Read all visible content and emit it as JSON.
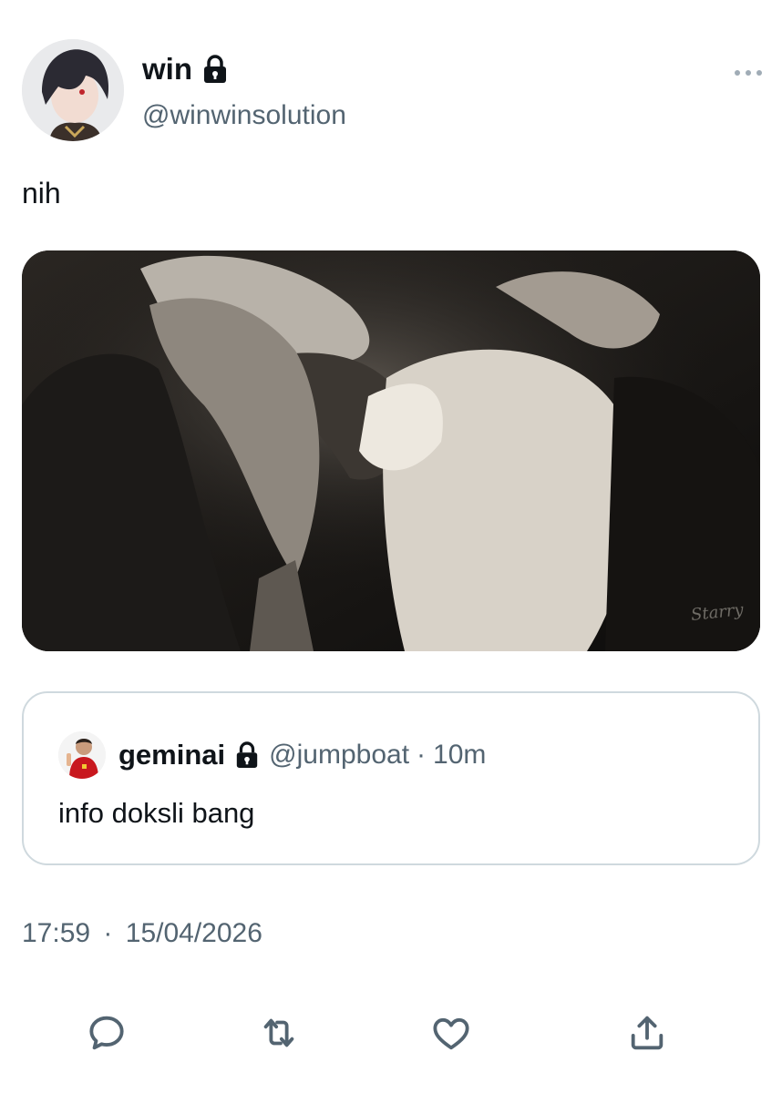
{
  "author": {
    "display_name": "win",
    "handle": "@winwinsolution",
    "verified_lock": true
  },
  "tweet": {
    "text": "nih",
    "media_watermark": "Starry"
  },
  "quoted": {
    "display_name": "geminai",
    "handle": "@jumpboat",
    "separator": "·",
    "age": "10m",
    "text": "info doksli bang"
  },
  "timestamp": {
    "time": "17:59",
    "separator": "·",
    "date": "15/04/2026"
  },
  "actions": [
    "reply-icon",
    "retweet-icon",
    "like-icon",
    "share-icon"
  ],
  "colors": {
    "text": "#0f1419",
    "secondary": "#536471",
    "border": "#cfd9de"
  }
}
